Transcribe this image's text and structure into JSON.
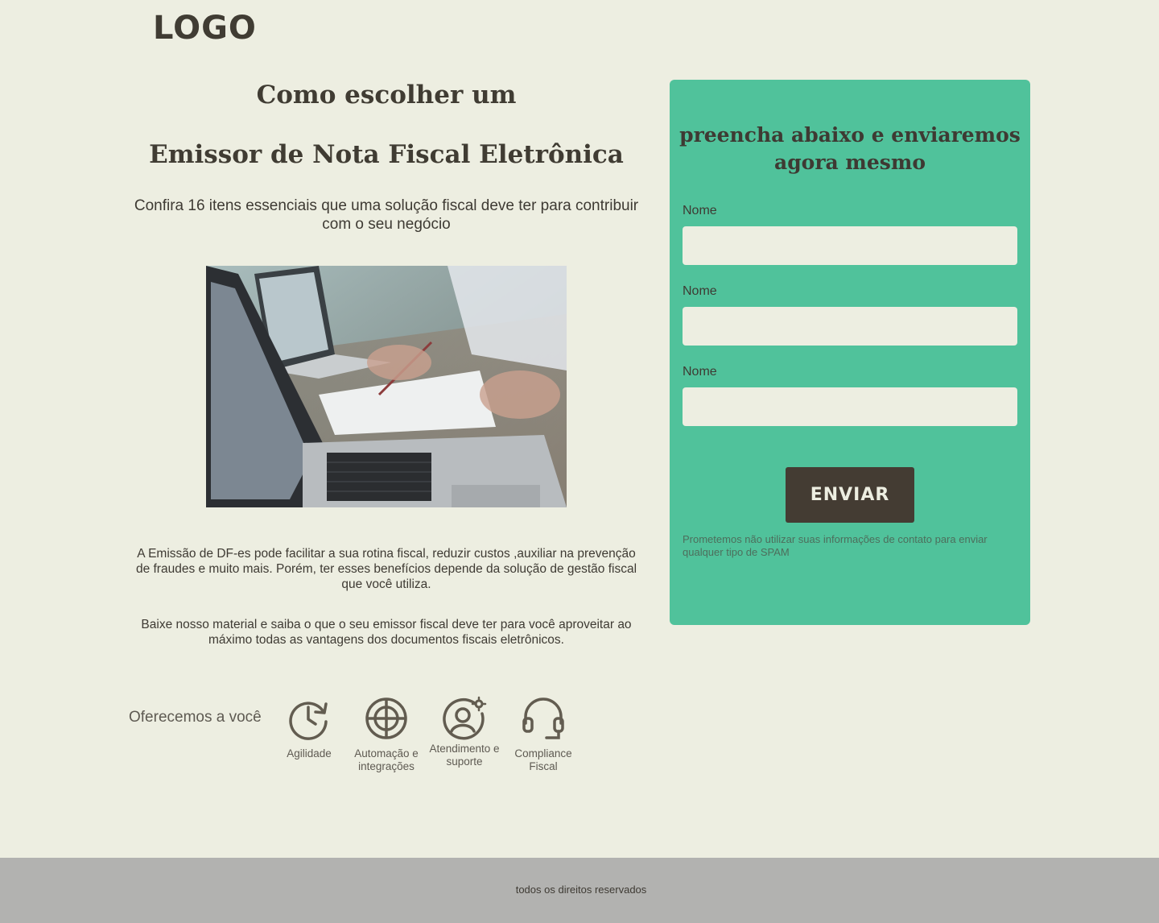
{
  "header": {
    "logo": "LOGO"
  },
  "hero": {
    "title_line1": "Como escolher um",
    "title_line2": "Emissor de Nota Fiscal Eletrônica",
    "subtitle": "Confira 16 itens essenciais que uma solução fiscal deve ter para contribuir com o seu negócio"
  },
  "content": {
    "paragraph1": "A Emissão de DF-es pode facilitar a sua rotina fiscal, reduzir custos ,auxiliar na prevenção de fraudes e muito mais. Porém, ter esses benefícios depende da solução de gestão fiscal que você utiliza.",
    "paragraph2": "Baixe nosso material e saiba o que o seu emissor fiscal deve ter para você aproveitar ao máximo todas as vantagens dos documentos fiscais eletrônicos."
  },
  "offer": {
    "label": "Oferecemos a você",
    "features": [
      {
        "label": "Agilidade",
        "icon": "clock-refresh-icon"
      },
      {
        "label": "Automação e integrações",
        "icon": "target-icon"
      },
      {
        "label": "Atendimento e suporte",
        "icon": "user-gear-icon"
      },
      {
        "label": "Compliance Fiscal",
        "icon": "headset-icon"
      }
    ]
  },
  "form": {
    "title": "preencha abaixo e enviaremos agora mesmo",
    "fields": [
      {
        "label": "Nome",
        "value": ""
      },
      {
        "label": "Nome",
        "value": ""
      },
      {
        "label": "Nome",
        "value": ""
      }
    ],
    "submit_label": "ENVIAR",
    "disclaimer": "Prometemos não utilizar suas informações de contato para enviar qualquer tipo de SPAM"
  },
  "footer": {
    "text": "todos os direitos reservados"
  },
  "colors": {
    "background": "#edeee1",
    "form_background": "#50c29b",
    "button": "#443c33",
    "footer": "#b2b2b0",
    "text": "#3e3a33"
  }
}
